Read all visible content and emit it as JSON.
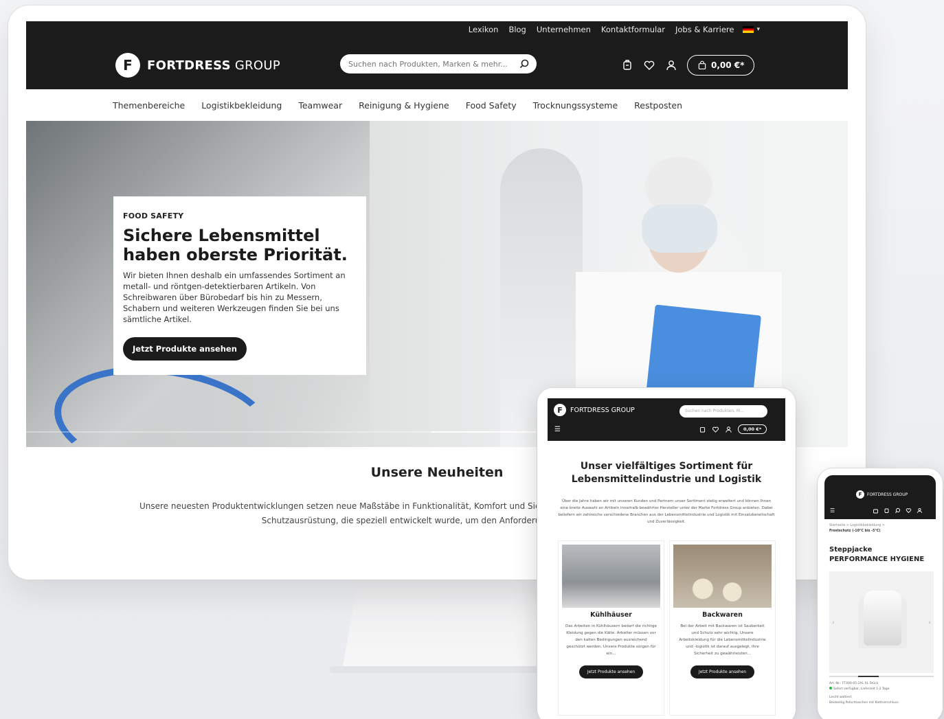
{
  "desktop": {
    "topbar": {
      "links": [
        "Lexikon",
        "Blog",
        "Unternehmen",
        "Kontaktformular",
        "Jobs & Karriere"
      ]
    },
    "brand": {
      "strong": "FORTDRESS",
      "light": " GROUP",
      "badge": "F"
    },
    "search": {
      "placeholder": "Suchen nach Produkten, Marken & mehr..."
    },
    "cart": {
      "total": "0,00 €*"
    },
    "nav": [
      "Themenbereiche",
      "Logistikbekleidung",
      "Teamwear",
      "Reinigung & Hygiene",
      "Food Safety",
      "Trocknungssysteme",
      "Restposten"
    ],
    "hero": {
      "eyebrow": "FOOD SAFETY",
      "title": "Sichere Lebensmittel haben oberste Priorität.",
      "text": "Wir bieten Ihnen deshalb ein umfassendes Sortiment an metall- und röntgen-detektierbaren Artikeln. Von Schreibwaren über Bürobedarf bis hin zu Messern, Schabern und weiteren Werkzeugen finden Sie bei uns sämtliche Artikel.",
      "button": "Jetzt Produkte ansehen"
    },
    "news": {
      "heading": "Unsere Neuheiten",
      "text": "Unsere neuesten Produktentwicklungen setzen neue Maßstäbe in Funktionalität, Komfort und Sicherheit an innovativer Arbeitskleidung und Schutzausrüstung, die speziell entwickelt wurde, um den Anforderung... werden."
    }
  },
  "tablet": {
    "brand": "FORTDRESS GROUP",
    "search_placeholder": "Suchen nach Produkten, M...",
    "cart": "0,00 €*",
    "title": "Unser vielfältiges Sortiment für Lebensmittelindustrie und Logistik",
    "text": "Über die Jahre haben wir mit unseren Kunden und Partnern unser Sortiment stetig erweitert und können Ihnen eine breite Auswahl an Artikeln innerhalb bewährter Hersteller unter der Marke Fortdress Group anbieten. Dabei beliefern wir zahlreiche verschiedene Branchen aus der Lebensmittelindustrie und Logistik mit Einsatzbereitschaft und Zuverlässigkeit.",
    "cards": [
      {
        "title": "Kühlhäuser",
        "text": "Das Arbeiten in Kühlhäusern bedarf die richtige Kleidung gegen die Kälte. Arbeiter müssen vor den kalten Bedingungen ausreichend geschützt werden. Unsere Produkte sorgen für ein...",
        "button": "Jetzt Produkte ansehen"
      },
      {
        "title": "Backwaren",
        "text": "Bei der Arbeit mit Backwaren ist Sauberkeit und Schutz sehr wichtig. Unsere Arbeitskleidung für die Lebensmittelindustrie und -logistik ist darauf ausgelegt, Ihre Sicherheit zu gewährleisten...",
        "button": "Jetzt Produkte ansehen"
      }
    ]
  },
  "phone": {
    "brand": "FORTDRESS GROUP",
    "crumb": "Startseite > Logistikbekleidung >",
    "crumb_bold": "Frostschutz (-10°C bis -5°C)",
    "title": "Steppjacke PERFORMANCE HYGIENE",
    "meta1": "Art.-Nr.: FT400-05-2XL    XL Stück",
    "meta2": "Sofort verfügbar, Lieferzeit 1-2 Tage",
    "meta3": "Leicht wattiert",
    "meta4": "Beidseitig Potschtaschen mit Klettverschluss"
  },
  "colors": {
    "header": "#1b1b1b",
    "accent_blue": "#4a8fdf",
    "available_green": "#2db34a"
  }
}
